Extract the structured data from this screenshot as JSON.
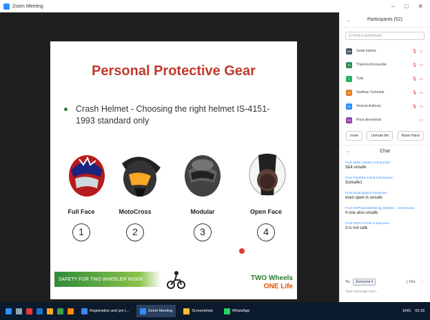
{
  "window": {
    "title": "Zoom Meeting",
    "controls": [
      "–",
      "□",
      "✕"
    ]
  },
  "slide": {
    "title": "Personal Protective Gear",
    "bullet": "Crash Helmet  - Choosing the right helmet IS-4151-1993 standard only",
    "helmets": [
      {
        "label": "Full Face",
        "num": "1"
      },
      {
        "label": "MotoCross",
        "num": "2"
      },
      {
        "label": "Modular",
        "num": "3"
      },
      {
        "label": "Open Face",
        "num": "4"
      }
    ],
    "footer_band": "SAFETY FOR TWO WHEELER RIDER",
    "footer_right_1": "TWO Wheels",
    "footer_right_2": "ONE Life"
  },
  "participants": {
    "header": "Participants (52)",
    "search_placeholder": "Q Find a participant",
    "list": [
      {
        "initials": "SM",
        "name": "Swati mishra",
        "color": "#2e7d32"
      },
      {
        "initials": "SM",
        "name": "Swati mishra",
        "color": "#455a64"
      },
      {
        "initials": "TK",
        "name": "Thenmozhi kounder",
        "color": "#2e8b57"
      },
      {
        "initials": "T",
        "name": "Tulsi",
        "color": "#27ae60"
      },
      {
        "initials": "VT",
        "name": "Vardhan Tummala",
        "color": "#e67e22"
      },
      {
        "initials": "VA",
        "name": "Victoria Anthony",
        "color": "#2d8cff"
      },
      {
        "initials": "PD",
        "name": "Priya devendran",
        "color": "#8e44ad"
      }
    ],
    "buttons": [
      "Invite",
      "Unmute Me",
      "Raise Hand"
    ]
  },
  "chat": {
    "header": "Chat",
    "messages": [
      {
        "from": "From ketan zalicker to Everyone:",
        "text": "3&4 unsafe"
      },
      {
        "from": "From Priyanka Anand to Everyone:",
        "text": "3unsafe1"
      },
      {
        "from": "From divya gupta to Everyone:",
        "text": "even open is unsafe"
      },
      {
        "from": "From NHP(sp)4mBr2IKHg_BEI5QA... to Everyone:",
        "text": "4 one also unsafe"
      },
      {
        "from": "From OPPO A37fw to Everyone:",
        "text": "3 is not safe"
      }
    ],
    "to_label": "To:",
    "to_value": "Everyone ▾",
    "file_label": "File",
    "more_label": "···",
    "type_placeholder": "Type message here..."
  },
  "taskbar": {
    "tasks": [
      {
        "label": "Registration and pre t...",
        "active": false
      },
      {
        "label": "Zoom Meeting",
        "active": true
      },
      {
        "label": "Screenshots",
        "active": false
      },
      {
        "label": "WhatsApp",
        "active": false
      }
    ],
    "tray_lang": "ENG",
    "tray_time": "03:18"
  }
}
